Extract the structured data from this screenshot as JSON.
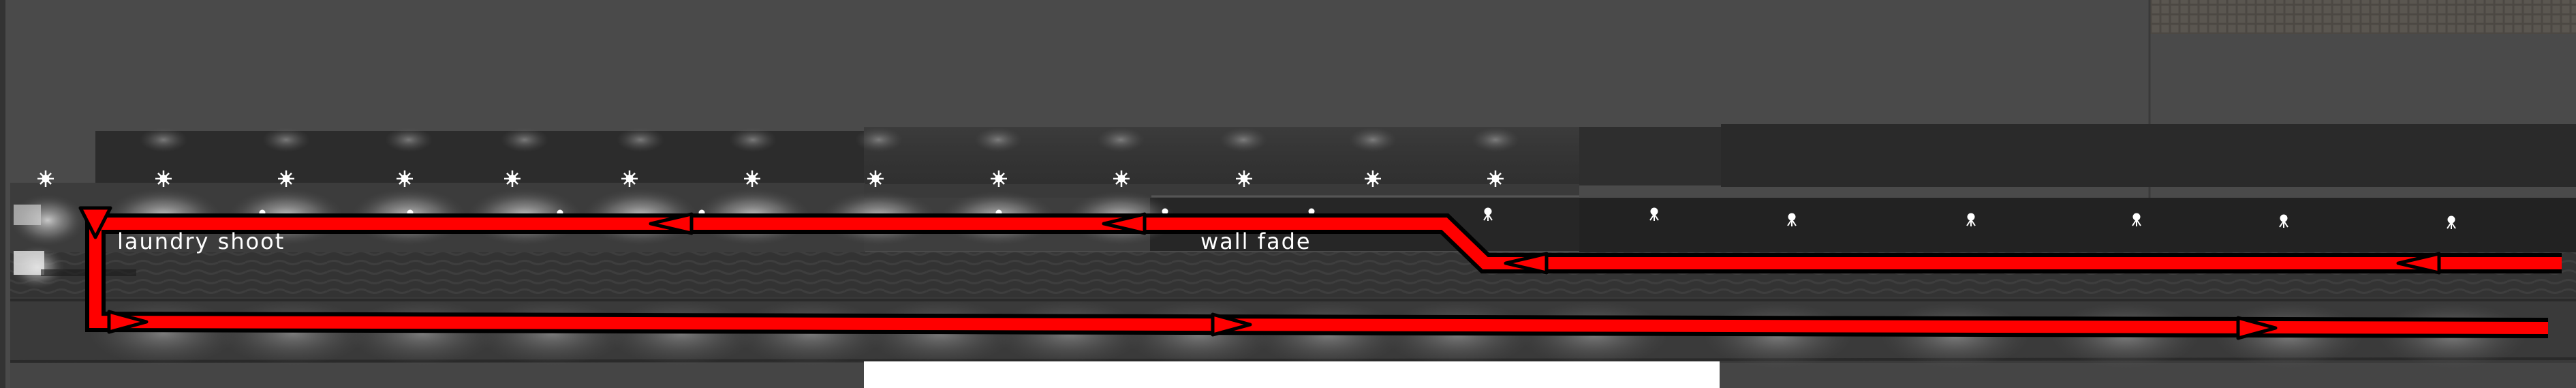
{
  "labels": {
    "laundry_shoot": "laundry shoot",
    "wall_fade": "wall fade"
  },
  "colors": {
    "route": "#ff0000",
    "route_outline": "#000000",
    "background": "#4a4a4a",
    "wall": "#2b2b2b",
    "floor": "#3a3a3a"
  },
  "icons": {
    "light_fixture": "sun-burst-icon",
    "ceiling_lamp": "ceiling-lamp-icon",
    "direction_arrow": "arrowhead-icon"
  }
}
